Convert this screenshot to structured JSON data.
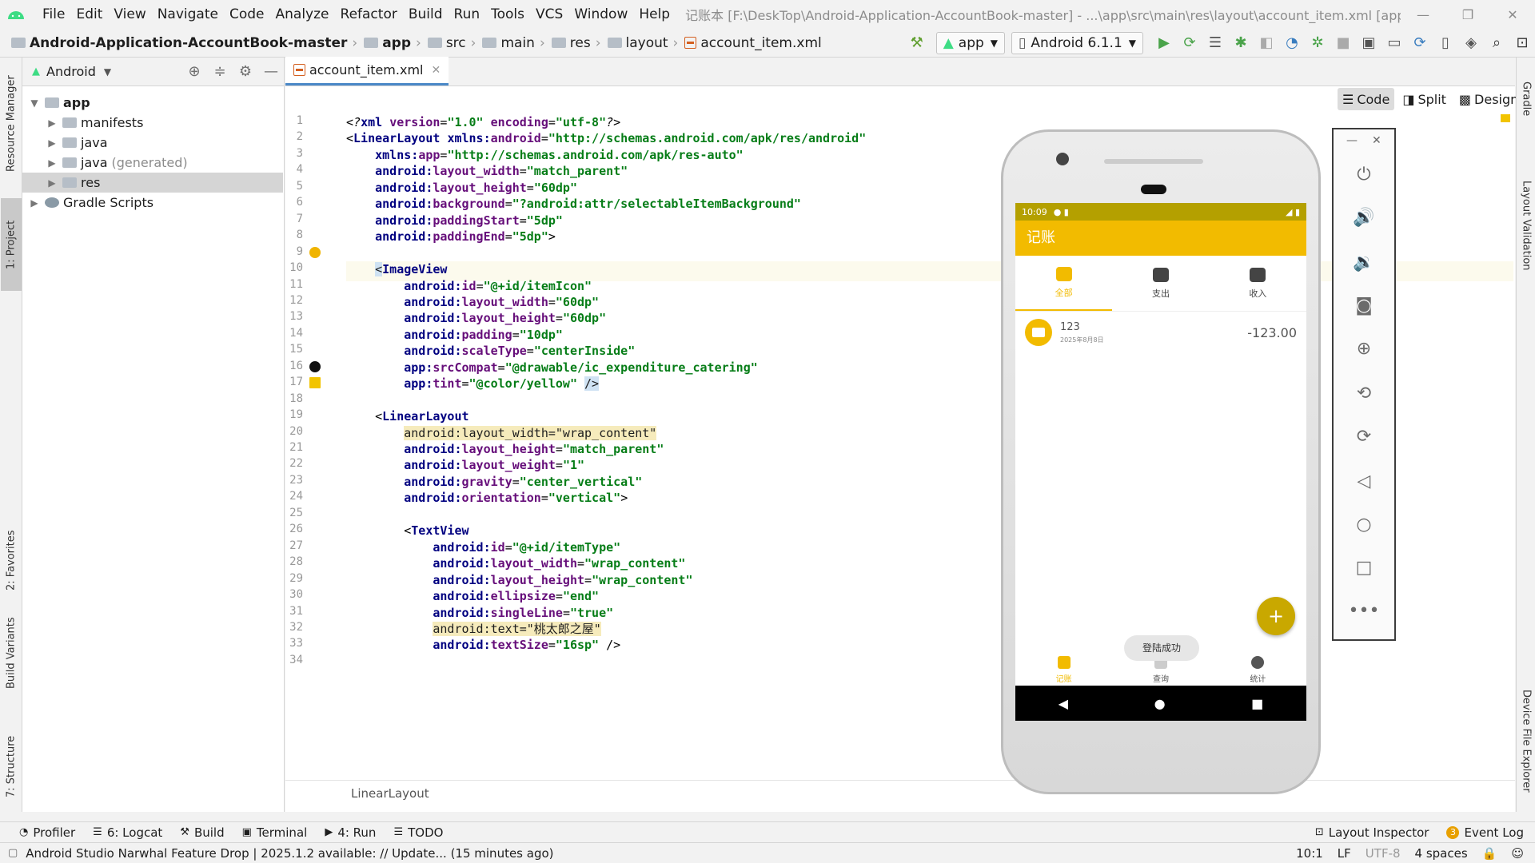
{
  "menubar": {
    "items": [
      "File",
      "Edit",
      "View",
      "Navigate",
      "Code",
      "Analyze",
      "Refactor",
      "Build",
      "Run",
      "Tools",
      "VCS",
      "Window",
      "Help"
    ],
    "title": "记账本 [F:\\DeskTop\\Android-Application-AccountBook-master] - ...\\app\\src\\main\\res\\layout\\account_item.xml [app]"
  },
  "breadcrumb": {
    "items": [
      "Android-Application-AccountBook-master",
      "app",
      "src",
      "main",
      "res",
      "layout",
      "account_item.xml"
    ]
  },
  "toolbar": {
    "config": "app",
    "device": "Android 6.1.1"
  },
  "project": {
    "view": "Android",
    "tree": [
      {
        "label": "app",
        "depth": 0,
        "bold": true
      },
      {
        "label": "manifests",
        "depth": 1
      },
      {
        "label": "java",
        "depth": 1
      },
      {
        "label": "java",
        "suffix": "(generated)",
        "depth": 1
      },
      {
        "label": "res",
        "depth": 1,
        "selected": true
      },
      {
        "label": "Gradle Scripts",
        "depth": 0
      }
    ]
  },
  "left_tabs": [
    "Resource Manager",
    "1: Project",
    "2: Favorites",
    "Build Variants",
    "7: Structure"
  ],
  "right_tabs": [
    "Gradle",
    "Layout Validation",
    "Device File Explorer"
  ],
  "editor": {
    "tab": "account_item.xml",
    "modes": [
      "Code",
      "Split",
      "Design"
    ],
    "footer_crumb": "LinearLayout",
    "lines": [
      [
        [
          "pi",
          "<?"
        ],
        [
          "ns",
          "xml "
        ],
        [
          "a",
          "version"
        ],
        [
          "p",
          "="
        ],
        [
          "v",
          "\"1.0\" "
        ],
        [
          "a",
          "encoding"
        ],
        [
          "p",
          "="
        ],
        [
          "v",
          "\"utf-8\""
        ],
        [
          "pi",
          "?>"
        ]
      ],
      [
        [
          "p",
          "<"
        ],
        [
          "t",
          "LinearLayout "
        ],
        [
          "ns",
          "xmlns:"
        ],
        [
          "a",
          "android"
        ],
        [
          "p",
          "="
        ],
        [
          "v",
          "\"http://schemas.android.com/apk/res/android\""
        ]
      ],
      [
        [
          "p",
          "    "
        ],
        [
          "ns",
          "xmlns:"
        ],
        [
          "a",
          "app"
        ],
        [
          "p",
          "="
        ],
        [
          "v",
          "\"http://schemas.android.com/apk/res-auto\""
        ]
      ],
      [
        [
          "p",
          "    "
        ],
        [
          "ns",
          "android:"
        ],
        [
          "a",
          "layout_width"
        ],
        [
          "p",
          "="
        ],
        [
          "v",
          "\"match_parent\""
        ]
      ],
      [
        [
          "p",
          "    "
        ],
        [
          "ns",
          "android:"
        ],
        [
          "a",
          "layout_height"
        ],
        [
          "p",
          "="
        ],
        [
          "v",
          "\"60dp\""
        ]
      ],
      [
        [
          "p",
          "    "
        ],
        [
          "ns",
          "android:"
        ],
        [
          "a",
          "background"
        ],
        [
          "p",
          "="
        ],
        [
          "v",
          "\"?android:attr/selectableItemBackground\""
        ]
      ],
      [
        [
          "p",
          "    "
        ],
        [
          "ns",
          "android:"
        ],
        [
          "a",
          "paddingStart"
        ],
        [
          "p",
          "="
        ],
        [
          "v",
          "\"5dp\""
        ]
      ],
      [
        [
          "p",
          "    "
        ],
        [
          "ns",
          "android:"
        ],
        [
          "a",
          "paddingEnd"
        ],
        [
          "p",
          "="
        ],
        [
          "v",
          "\"5dp\""
        ],
        [
          "p",
          ">"
        ]
      ],
      [
        [
          "p",
          ""
        ]
      ],
      [
        [
          "p",
          "    "
        ],
        [
          "sb",
          "<"
        ],
        [
          "t",
          "ImageView"
        ]
      ],
      [
        [
          "p",
          "        "
        ],
        [
          "ns",
          "android:"
        ],
        [
          "a",
          "id"
        ],
        [
          "p",
          "="
        ],
        [
          "v",
          "\"@+id/itemIcon\""
        ]
      ],
      [
        [
          "p",
          "        "
        ],
        [
          "ns",
          "android:"
        ],
        [
          "a",
          "layout_width"
        ],
        [
          "p",
          "="
        ],
        [
          "v",
          "\"60dp\""
        ]
      ],
      [
        [
          "p",
          "        "
        ],
        [
          "ns",
          "android:"
        ],
        [
          "a",
          "layout_height"
        ],
        [
          "p",
          "="
        ],
        [
          "v",
          "\"60dp\""
        ]
      ],
      [
        [
          "p",
          "        "
        ],
        [
          "ns",
          "android:"
        ],
        [
          "a",
          "padding"
        ],
        [
          "p",
          "="
        ],
        [
          "v",
          "\"10dp\""
        ]
      ],
      [
        [
          "p",
          "        "
        ],
        [
          "ns",
          "android:"
        ],
        [
          "a",
          "scaleType"
        ],
        [
          "p",
          "="
        ],
        [
          "v",
          "\"centerInside\""
        ]
      ],
      [
        [
          "p",
          "        "
        ],
        [
          "ns",
          "app:"
        ],
        [
          "a",
          "srcCompat"
        ],
        [
          "p",
          "="
        ],
        [
          "v",
          "\"@drawable/ic_expenditure_catering\""
        ]
      ],
      [
        [
          "p",
          "        "
        ],
        [
          "ns",
          "app:"
        ],
        [
          "a",
          "tint"
        ],
        [
          "p",
          "="
        ],
        [
          "v",
          "\"@color/yellow\" "
        ],
        [
          "sb",
          "/>"
        ]
      ],
      [
        [
          "p",
          ""
        ]
      ],
      [
        [
          "p",
          "    <"
        ],
        [
          "t",
          "LinearLayout"
        ]
      ],
      [
        [
          "p",
          "        "
        ],
        [
          "hl",
          "android:layout_width=\"wrap_content\""
        ]
      ],
      [
        [
          "p",
          "        "
        ],
        [
          "ns",
          "android:"
        ],
        [
          "a",
          "layout_height"
        ],
        [
          "p",
          "="
        ],
        [
          "v",
          "\"match_parent\""
        ]
      ],
      [
        [
          "p",
          "        "
        ],
        [
          "ns",
          "android:"
        ],
        [
          "a",
          "layout_weight"
        ],
        [
          "p",
          "="
        ],
        [
          "v",
          "\"1\""
        ]
      ],
      [
        [
          "p",
          "        "
        ],
        [
          "ns",
          "android:"
        ],
        [
          "a",
          "gravity"
        ],
        [
          "p",
          "="
        ],
        [
          "v",
          "\"center_vertical\""
        ]
      ],
      [
        [
          "p",
          "        "
        ],
        [
          "ns",
          "android:"
        ],
        [
          "a",
          "orientation"
        ],
        [
          "p",
          "="
        ],
        [
          "v",
          "\"vertical\""
        ],
        [
          "p",
          ">"
        ]
      ],
      [
        [
          "p",
          ""
        ]
      ],
      [
        [
          "p",
          "        <"
        ],
        [
          "t",
          "TextView"
        ]
      ],
      [
        [
          "p",
          "            "
        ],
        [
          "ns",
          "android:"
        ],
        [
          "a",
          "id"
        ],
        [
          "p",
          "="
        ],
        [
          "v",
          "\"@+id/itemType\""
        ]
      ],
      [
        [
          "p",
          "            "
        ],
        [
          "ns",
          "android:"
        ],
        [
          "a",
          "layout_width"
        ],
        [
          "p",
          "="
        ],
        [
          "v",
          "\"wrap_content\""
        ]
      ],
      [
        [
          "p",
          "            "
        ],
        [
          "ns",
          "android:"
        ],
        [
          "a",
          "layout_height"
        ],
        [
          "p",
          "="
        ],
        [
          "v",
          "\"wrap_content\""
        ]
      ],
      [
        [
          "p",
          "            "
        ],
        [
          "ns",
          "android:"
        ],
        [
          "a",
          "ellipsize"
        ],
        [
          "p",
          "="
        ],
        [
          "v",
          "\"end\""
        ]
      ],
      [
        [
          "p",
          "            "
        ],
        [
          "ns",
          "android:"
        ],
        [
          "a",
          "singleLine"
        ],
        [
          "p",
          "="
        ],
        [
          "v",
          "\"true\""
        ]
      ],
      [
        [
          "p",
          "            "
        ],
        [
          "hl",
          "android:text=\"桃太郎之屋\""
        ]
      ],
      [
        [
          "p",
          "            "
        ],
        [
          "ns",
          "android:"
        ],
        [
          "a",
          "textSize"
        ],
        [
          "p",
          "="
        ],
        [
          "v",
          "\"16sp\" "
        ],
        [
          "p",
          "/>"
        ]
      ],
      [
        [
          "p",
          ""
        ]
      ]
    ]
  },
  "phone": {
    "time": "10:09",
    "app_title": "记账",
    "tabs": [
      "全部",
      "支出",
      "收入"
    ],
    "item_name": "123",
    "item_date": "2025年8月8日",
    "item_amount": "-123.00",
    "toast": "登陆成功",
    "fab": "+",
    "bottom_nav": [
      "记账",
      "查询",
      "统计"
    ]
  },
  "toolwindows": [
    "Profiler",
    "6: Logcat",
    "Build",
    "Terminal",
    "4: Run",
    "TODO"
  ],
  "toolwindows_right": [
    "Layout Inspector",
    "Event Log"
  ],
  "event_count": "3",
  "status": {
    "message": "Android Studio Narwhal Feature Drop | 2025.1.2 available: // Update... (15 minutes ago)",
    "position": "10:1",
    "line_sep": "LF",
    "encoding": "UTF-8",
    "indent": "4 spaces"
  },
  "colors": {
    "accent": "#4a88c7",
    "app_yellow": "#f2bb00",
    "app_status": "#b4a000"
  }
}
